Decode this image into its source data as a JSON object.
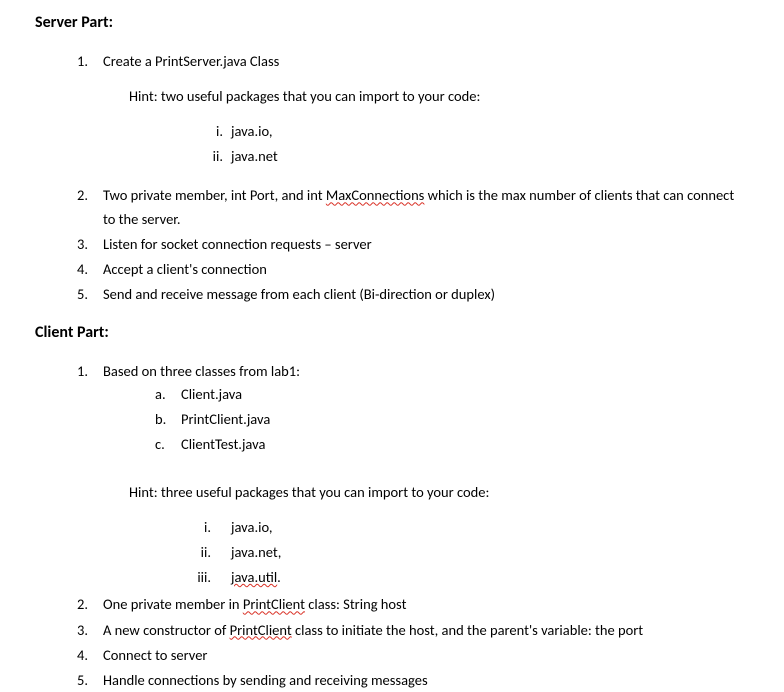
{
  "server": {
    "heading": "Server Part:",
    "items": [
      {
        "marker": "1.",
        "text": "Create a PrintServer.java Class",
        "hint": "Hint: two useful packages that you can import to your code:",
        "roman": [
          {
            "marker": "i.",
            "text": "java.io,"
          },
          {
            "marker": "ii.",
            "text": "java.net"
          }
        ]
      },
      {
        "marker": "2.",
        "pre": "Two private member, int Port, and int ",
        "err": "MaxConnections",
        "post": " which is the max number of clients that can connect to the server."
      },
      {
        "marker": "3.",
        "text": "Listen for socket connection requests – server"
      },
      {
        "marker": "4.",
        "text": "Accept a client's connection"
      },
      {
        "marker": "5.",
        "text": "Send and receive message from each client (Bi-direction or duplex)"
      }
    ]
  },
  "client": {
    "heading": "Client Part:",
    "items": [
      {
        "marker": "1.",
        "text": "Based on three classes from lab1:",
        "alpha": [
          {
            "marker": "a.",
            "text": "Client.java"
          },
          {
            "marker": "b.",
            "text": "PrintClient.java"
          },
          {
            "marker": "c.",
            "text": "ClientTest.java"
          }
        ],
        "hint": "Hint: three useful packages that you can import to your code:",
        "roman": [
          {
            "marker": "i.",
            "text": "java.io,"
          },
          {
            "marker": "ii.",
            "text": "java.net,"
          },
          {
            "marker": "iii.",
            "err": "java.util",
            "post": "."
          }
        ]
      },
      {
        "marker": "2.",
        "pre": "One private member in ",
        "err": "PrintClient",
        "post": " class: String host"
      },
      {
        "marker": "3.",
        "pre": "A new constructor of ",
        "err": "PrintClient",
        "post": " class to initiate the host, and the parent's variable: the port"
      },
      {
        "marker": "4.",
        "text": "Connect to server"
      },
      {
        "marker": "5.",
        "text": "Handle connections by sending and receiving messages"
      }
    ]
  }
}
